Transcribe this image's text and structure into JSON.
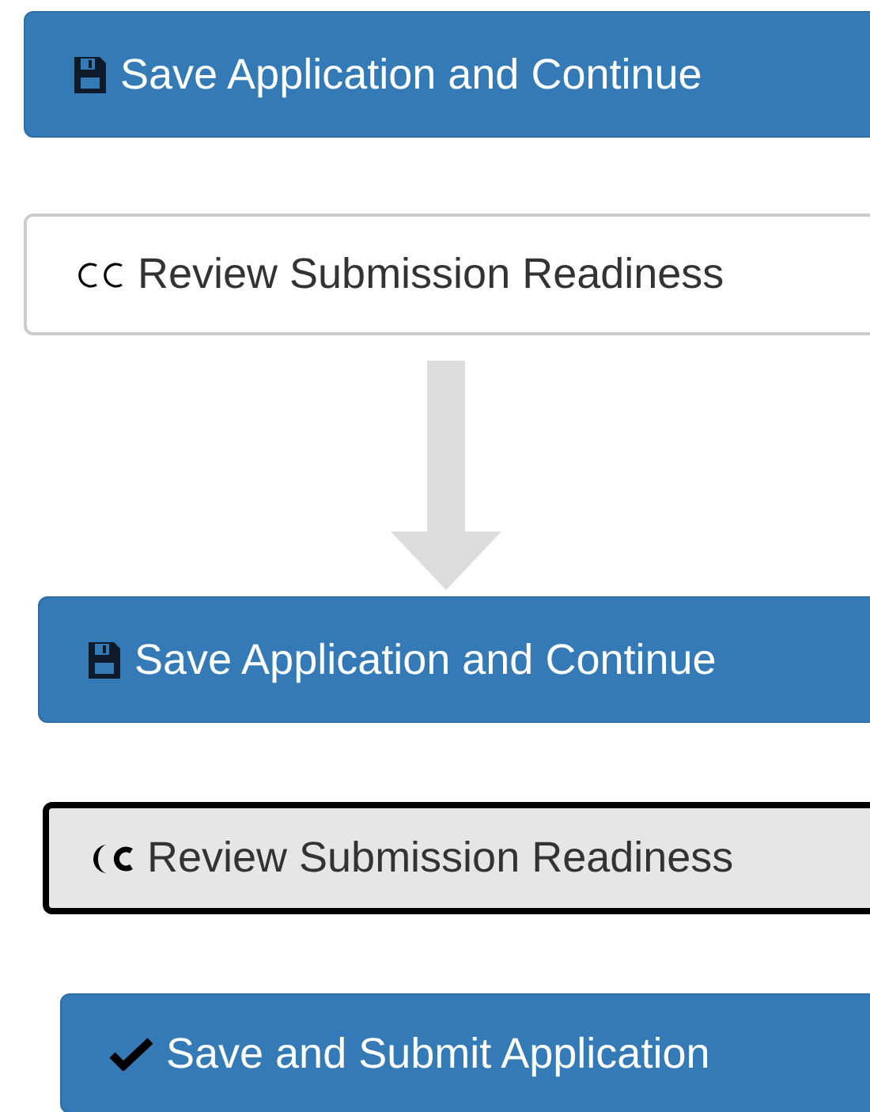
{
  "before": {
    "buttons": [
      {
        "kind": "save",
        "label": "Save Application and Continue",
        "focused": false
      },
      {
        "kind": "review",
        "label": "Review Submission Readiness",
        "focused": false
      }
    ]
  },
  "after": {
    "buttons": [
      {
        "kind": "save",
        "label": "Save Application and Continue",
        "focused": false
      },
      {
        "kind": "review",
        "label": "Review Submission Readiness",
        "focused": true
      },
      {
        "kind": "submit",
        "label": "Save and Submit Application",
        "focused": false
      }
    ]
  }
}
